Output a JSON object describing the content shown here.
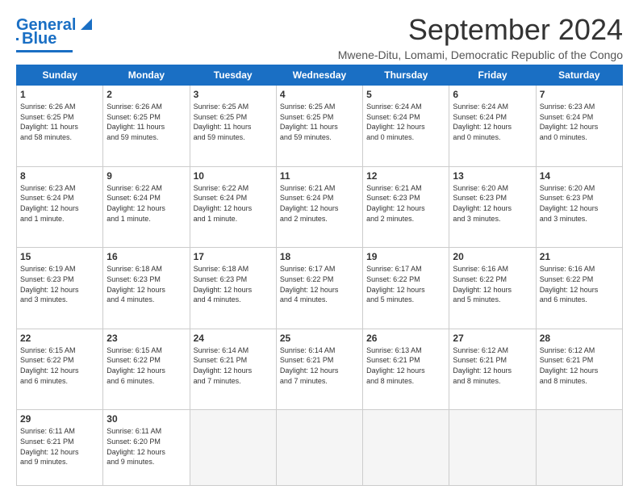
{
  "logo": {
    "line1": "General",
    "line2": "Blue"
  },
  "header": {
    "month": "September 2024",
    "location": "Mwene-Ditu, Lomami, Democratic Republic of the Congo"
  },
  "days_of_week": [
    "Sunday",
    "Monday",
    "Tuesday",
    "Wednesday",
    "Thursday",
    "Friday",
    "Saturday"
  ],
  "weeks": [
    [
      {
        "day": "1",
        "info": "Sunrise: 6:26 AM\nSunset: 6:25 PM\nDaylight: 11 hours\nand 58 minutes."
      },
      {
        "day": "2",
        "info": "Sunrise: 6:26 AM\nSunset: 6:25 PM\nDaylight: 11 hours\nand 59 minutes."
      },
      {
        "day": "3",
        "info": "Sunrise: 6:25 AM\nSunset: 6:25 PM\nDaylight: 11 hours\nand 59 minutes."
      },
      {
        "day": "4",
        "info": "Sunrise: 6:25 AM\nSunset: 6:25 PM\nDaylight: 11 hours\nand 59 minutes."
      },
      {
        "day": "5",
        "info": "Sunrise: 6:24 AM\nSunset: 6:24 PM\nDaylight: 12 hours\nand 0 minutes."
      },
      {
        "day": "6",
        "info": "Sunrise: 6:24 AM\nSunset: 6:24 PM\nDaylight: 12 hours\nand 0 minutes."
      },
      {
        "day": "7",
        "info": "Sunrise: 6:23 AM\nSunset: 6:24 PM\nDaylight: 12 hours\nand 0 minutes."
      }
    ],
    [
      {
        "day": "8",
        "info": "Sunrise: 6:23 AM\nSunset: 6:24 PM\nDaylight: 12 hours\nand 1 minute."
      },
      {
        "day": "9",
        "info": "Sunrise: 6:22 AM\nSunset: 6:24 PM\nDaylight: 12 hours\nand 1 minute."
      },
      {
        "day": "10",
        "info": "Sunrise: 6:22 AM\nSunset: 6:24 PM\nDaylight: 12 hours\nand 1 minute."
      },
      {
        "day": "11",
        "info": "Sunrise: 6:21 AM\nSunset: 6:24 PM\nDaylight: 12 hours\nand 2 minutes."
      },
      {
        "day": "12",
        "info": "Sunrise: 6:21 AM\nSunset: 6:23 PM\nDaylight: 12 hours\nand 2 minutes."
      },
      {
        "day": "13",
        "info": "Sunrise: 6:20 AM\nSunset: 6:23 PM\nDaylight: 12 hours\nand 3 minutes."
      },
      {
        "day": "14",
        "info": "Sunrise: 6:20 AM\nSunset: 6:23 PM\nDaylight: 12 hours\nand 3 minutes."
      }
    ],
    [
      {
        "day": "15",
        "info": "Sunrise: 6:19 AM\nSunset: 6:23 PM\nDaylight: 12 hours\nand 3 minutes."
      },
      {
        "day": "16",
        "info": "Sunrise: 6:18 AM\nSunset: 6:23 PM\nDaylight: 12 hours\nand 4 minutes."
      },
      {
        "day": "17",
        "info": "Sunrise: 6:18 AM\nSunset: 6:23 PM\nDaylight: 12 hours\nand 4 minutes."
      },
      {
        "day": "18",
        "info": "Sunrise: 6:17 AM\nSunset: 6:22 PM\nDaylight: 12 hours\nand 4 minutes."
      },
      {
        "day": "19",
        "info": "Sunrise: 6:17 AM\nSunset: 6:22 PM\nDaylight: 12 hours\nand 5 minutes."
      },
      {
        "day": "20",
        "info": "Sunrise: 6:16 AM\nSunset: 6:22 PM\nDaylight: 12 hours\nand 5 minutes."
      },
      {
        "day": "21",
        "info": "Sunrise: 6:16 AM\nSunset: 6:22 PM\nDaylight: 12 hours\nand 6 minutes."
      }
    ],
    [
      {
        "day": "22",
        "info": "Sunrise: 6:15 AM\nSunset: 6:22 PM\nDaylight: 12 hours\nand 6 minutes."
      },
      {
        "day": "23",
        "info": "Sunrise: 6:15 AM\nSunset: 6:22 PM\nDaylight: 12 hours\nand 6 minutes."
      },
      {
        "day": "24",
        "info": "Sunrise: 6:14 AM\nSunset: 6:21 PM\nDaylight: 12 hours\nand 7 minutes."
      },
      {
        "day": "25",
        "info": "Sunrise: 6:14 AM\nSunset: 6:21 PM\nDaylight: 12 hours\nand 7 minutes."
      },
      {
        "day": "26",
        "info": "Sunrise: 6:13 AM\nSunset: 6:21 PM\nDaylight: 12 hours\nand 8 minutes."
      },
      {
        "day": "27",
        "info": "Sunrise: 6:12 AM\nSunset: 6:21 PM\nDaylight: 12 hours\nand 8 minutes."
      },
      {
        "day": "28",
        "info": "Sunrise: 6:12 AM\nSunset: 6:21 PM\nDaylight: 12 hours\nand 8 minutes."
      }
    ],
    [
      {
        "day": "29",
        "info": "Sunrise: 6:11 AM\nSunset: 6:21 PM\nDaylight: 12 hours\nand 9 minutes."
      },
      {
        "day": "30",
        "info": "Sunrise: 6:11 AM\nSunset: 6:20 PM\nDaylight: 12 hours\nand 9 minutes."
      },
      {
        "day": "",
        "info": ""
      },
      {
        "day": "",
        "info": ""
      },
      {
        "day": "",
        "info": ""
      },
      {
        "day": "",
        "info": ""
      },
      {
        "day": "",
        "info": ""
      }
    ]
  ]
}
